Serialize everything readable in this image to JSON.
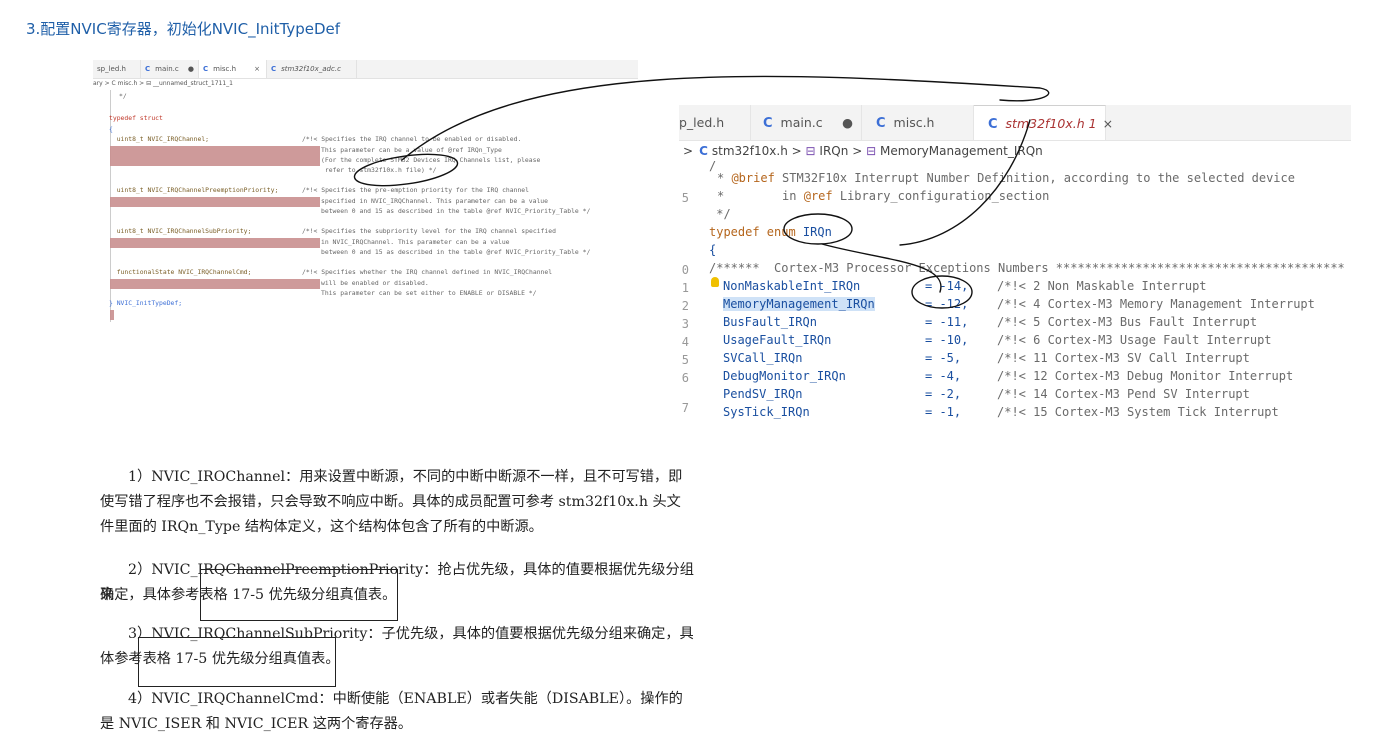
{
  "heading": "3.配置NVIC寄存器，初始化NVIC_InitTypeDef",
  "small_editor": {
    "tabs": [
      {
        "icon": "",
        "label": "sp_led.h"
      },
      {
        "icon": "C",
        "label": "main.c",
        "marker": "●"
      },
      {
        "icon": "C",
        "label": "misc.h",
        "marker": "×"
      },
      {
        "icon": "C",
        "label": "stm32f10x_adc.c"
      }
    ],
    "breadcrumb": "ary > C misc.h > ⊟ __unnamed_struct_1711_1",
    "lines": [
      "*/",
      "typedef struct",
      "{",
      "  uint8_t NVIC_IRQChannel;",
      "  uint8_t NVIC_IRQChannelPreemptionPriority;",
      "  uint8_t NVIC_IRQChannelSubPriority;",
      "  functionalState NVIC_IRQChannelCmd;",
      "} NVIC_InitTypeDef;"
    ],
    "comments": [
      "/*!< Specifies the IRQ channel to be enabled or disabled.",
      "This parameter can be a value of @ref IRQn_Type",
      "(For the complete STM32 Devices IRQ Channels list, please",
      " refer to stm32f10x.h file) */",
      "/*!< Specifies the pre-emption priority for the IRQ channel",
      "specified in NVIC_IRQChannel. This parameter can be a value",
      "between 0 and 15 as described in the table @ref NVIC_Priority_Table */",
      "/*!< Specifies the subpriority level for the IRQ channel specified",
      "in NVIC_IRQChannel. This parameter can be a value",
      "between 0 and 15 as described in the table @ref NVIC_Priority_Table */",
      "/*!< Specifies whether the IRQ channel defined in NVIC_IRQChannel",
      "will be enabled or disabled.",
      "This parameter can be set either to ENABLE or DISABLE */"
    ]
  },
  "big_editor": {
    "tabs": [
      {
        "icon": "",
        "label": "p_led.h"
      },
      {
        "icon": "C",
        "label": "main.c",
        "marker": "●"
      },
      {
        "icon": "C",
        "label": "misc.h"
      },
      {
        "icon": "C",
        "label": "stm32f10x.h 1",
        "marker": "×"
      }
    ],
    "breadcrumb": {
      "file": "stm32f10x.h",
      "sym1": "IRQn",
      "sym2": "MemoryManagement_IRQn"
    },
    "line_numbers": [
      "",
      "",
      "5",
      "",
      "",
      "",
      "0",
      "1",
      "2",
      "3",
      "4",
      "5",
      "6",
      "7"
    ],
    "header_lines": {
      "l0": "/",
      "l1_tag": "@brief",
      "l1_text": " STM32F10x Interrupt Number Definition, according to the selected device",
      "l2_pre": "        in ",
      "l2_tag": "@ref",
      "l2_text": " Library_configuration_section",
      "l3": " */",
      "l4_kw": "typedef enum ",
      "l4_id": "IRQn",
      "l5": "{",
      "l6": "/******  Cortex-M3 Processor Exceptions Numbers ****************************************"
    },
    "enum_rows": [
      {
        "name": "NonMaskableInt_IRQn",
        "value": "= -14,",
        "comment": "/*!< 2 Non Maskable Interrupt"
      },
      {
        "name": "MemoryManagement_IRQn",
        "value": "= -12,",
        "comment": "/*!< 4 Cortex-M3 Memory Management Interrupt"
      },
      {
        "name": "BusFault_IRQn",
        "value": "= -11,",
        "comment": "/*!< 5 Cortex-M3 Bus Fault Interrupt"
      },
      {
        "name": "UsageFault_IRQn",
        "value": "= -10,",
        "comment": "/*!< 6 Cortex-M3 Usage Fault Interrupt"
      },
      {
        "name": "SVCall_IRQn",
        "value": "= -5,",
        "comment": "/*!< 11 Cortex-M3 SV Call Interrupt"
      },
      {
        "name": "DebugMonitor_IRQn",
        "value": "= -4,",
        "comment": "/*!< 12 Cortex-M3 Debug Monitor Interrupt"
      },
      {
        "name": "PendSV_IRQn",
        "value": "= -2,",
        "comment": "/*!< 14 Cortex-M3 Pend SV Interrupt"
      },
      {
        "name": "SysTick_IRQn",
        "value": "= -1,",
        "comment": "/*!< 15 Cortex-M3 System Tick Interrupt"
      }
    ]
  },
  "paragraphs": {
    "p1_l1": "1）NVIC_IROChannel：用来设置中断源，不同的中断中断源不一样，且不可写错，即",
    "p1_l2": "使写错了程序也不会报错，只会导致不响应中断。具体的成员配置可参考 stm32f10x.h 头文",
    "p1_l3": "件里面的 IRQn_Type 结构体定义，这个结构体包含了所有的中断源。",
    "p2_l1": "2）NVIC_IRQChannelPreemptionPriority：抢占优先级，具体的值要根据优先级分组来",
    "p2_l2_pre": "确定，具体参考",
    "p2_l2_box": "表格 17-5 优先级分组真值表",
    "p2_l2_post": "。",
    "p3_l1": "3）NVIC_IRQChannelSubPriority：子优先级，具体的值要根据优先级分组来确定，具",
    "p3_l2_pre": "体参考",
    "p3_l2_box": "表格 17-5 优先级分组真值表",
    "p3_l2_post": "。",
    "p4_l1": "4）NVIC_IRQChannelCmd：中断使能（ENABLE）或者失能（DISABLE）。操作的",
    "p4_l2": "是 NVIC_ISER 和 NVIC_ICER 这两个寄存器。"
  }
}
